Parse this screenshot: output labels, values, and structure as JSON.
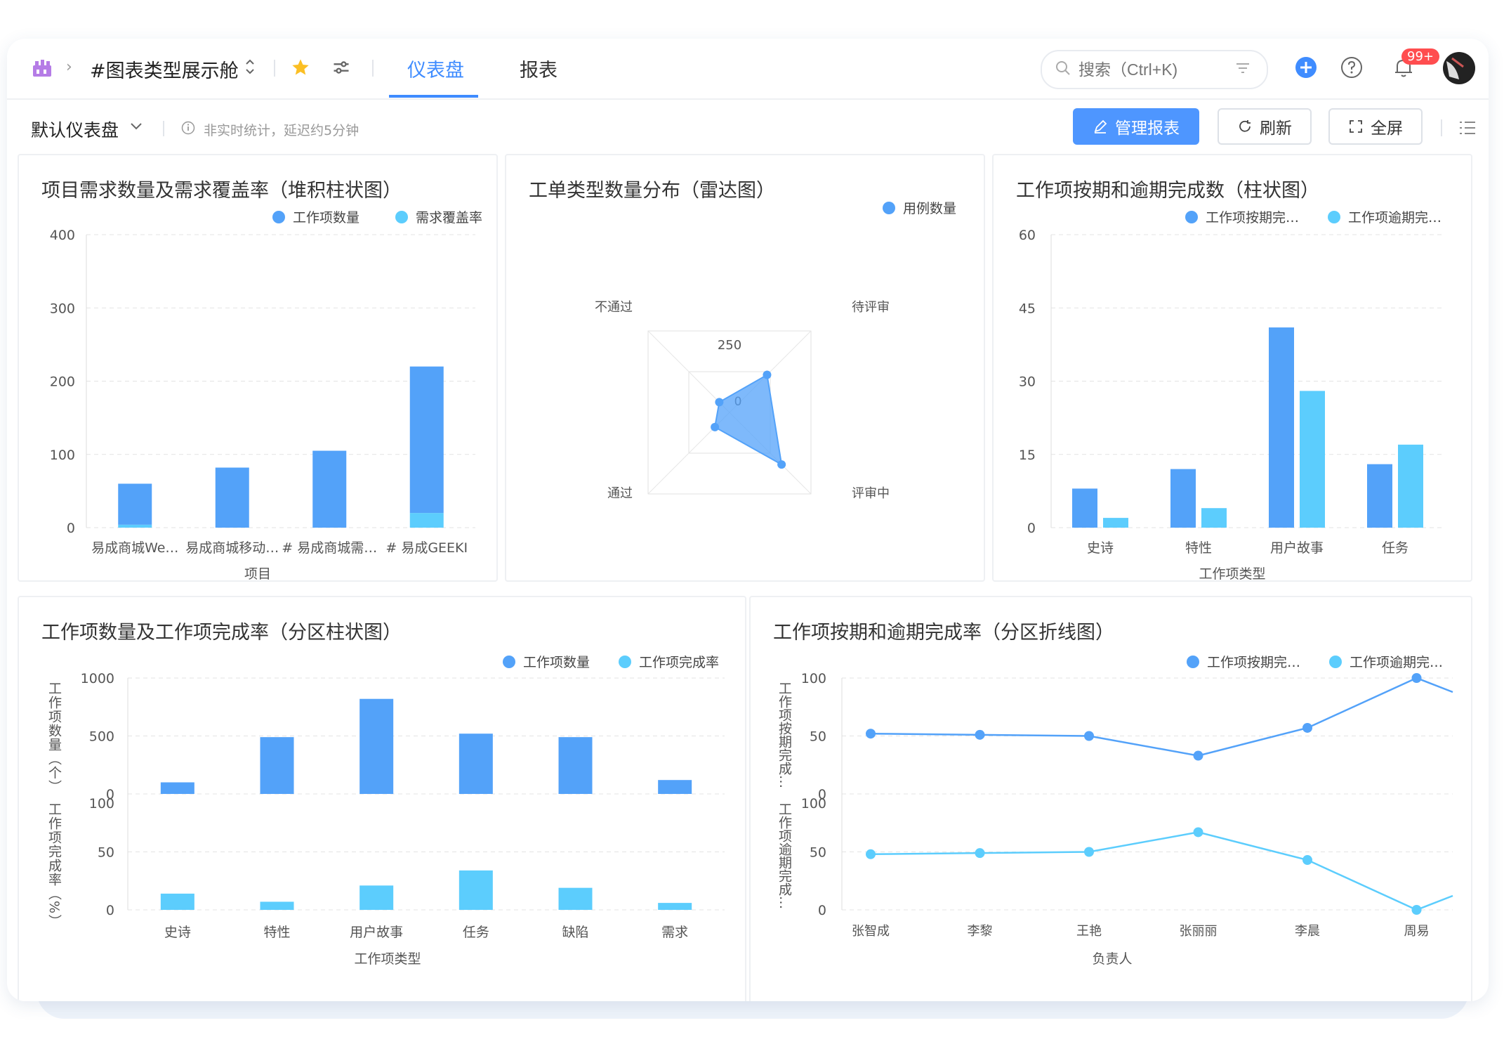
{
  "topbar": {
    "project_title": "#图表类型展示舱",
    "tabs": [
      {
        "label": "仪表盘",
        "active": true
      },
      {
        "label": "报表",
        "active": false
      }
    ],
    "search_placeholder": "搜索（Ctrl+K)",
    "notification_count": "99+"
  },
  "toolbar": {
    "dashboard_name": "默认仪表盘",
    "info_text": "非实时统计，延迟约5分钟",
    "manage_label": "管理报表",
    "refresh_label": "刷新",
    "fullscreen_label": "全屏"
  },
  "colors": {
    "primary": "#4e96ff",
    "dark_bar": "#53a2f9",
    "light_bar": "#5ccdfd",
    "accent": "#3f8cff"
  },
  "charts": {
    "stacked": {
      "title": "项目需求数量及需求覆盖率（堆积柱状图）",
      "legend": [
        "工作项数量",
        "需求覆盖率"
      ],
      "xlabel": "项目",
      "y_ticks": [
        "400",
        "300",
        "200",
        "100",
        "0"
      ],
      "x_labels": [
        "易成商城We…",
        "易成商城移动…",
        "# 易成商城需…",
        "# 易成GEEKI"
      ]
    },
    "radar": {
      "title": "工单类型数量分布（雷达图）",
      "legend": [
        "用例数量"
      ],
      "axes": [
        "待评审",
        "评审中",
        "通过",
        "不通过"
      ],
      "ring_labels": [
        "250",
        "0"
      ]
    },
    "bar": {
      "title": "工作项按期和逾期完成数（柱状图）",
      "legend": [
        "工作项按期完…",
        "工作项逾期完…"
      ],
      "xlabel": "工作项类型",
      "y_ticks": [
        "60",
        "45",
        "30",
        "15",
        "0"
      ],
      "x_labels": [
        "史诗",
        "特性",
        "用户故事",
        "任务"
      ]
    },
    "split_bar": {
      "title": "工作项数量及工作项完成率（分区柱状图）",
      "legend": [
        "工作项数量",
        "工作项完成率"
      ],
      "xlabel": "工作项类型",
      "ylabel_top": "工作项数量（个）",
      "ylabel_bottom": "工作项完成率（%）",
      "top_ticks": [
        "1000",
        "500",
        "0"
      ],
      "bottom_ticks": [
        "100",
        "50",
        "0"
      ],
      "x_labels": [
        "史诗",
        "特性",
        "用户故事",
        "任务",
        "缺陷",
        "需求"
      ]
    },
    "split_line": {
      "title": "工作项按期和逾期完成率（分区折线图）",
      "legend": [
        "工作项按期完…",
        "工作项逾期完…"
      ],
      "xlabel": "负责人",
      "ylabel_top": "工作项按期完成…",
      "ylabel_bottom": "工作项逾期完成…",
      "top_ticks": [
        "100",
        "50",
        "0"
      ],
      "bottom_ticks": [
        "100",
        "50",
        "0"
      ],
      "x_labels": [
        "张智成",
        "李黎",
        "王艳",
        "张丽丽",
        "李晨",
        "周易"
      ]
    }
  },
  "chart_data": [
    {
      "type": "bar",
      "title": "项目需求数量及需求覆盖率（堆积柱状图）",
      "xlabel": "项目",
      "stacked": true,
      "ylim": [
        0,
        400
      ],
      "categories": [
        "易成商城We…",
        "易成商城移动…",
        "# 易成商城需…",
        "# 易成GEEKI"
      ],
      "series": [
        {
          "name": "工作项数量",
          "values": [
            56,
            82,
            105,
            200
          ]
        },
        {
          "name": "需求覆盖率",
          "values": [
            4,
            0,
            0,
            20
          ]
        }
      ]
    },
    {
      "type": "radar",
      "title": "工单类型数量分布（雷达图）",
      "axes": [
        "待评审",
        "评审中",
        "通过",
        "不通过"
      ],
      "series": [
        {
          "name": "用例数量",
          "values": [
            180,
            300,
            50,
            25
          ]
        }
      ]
    },
    {
      "type": "bar",
      "title": "工作项按期和逾期完成数（柱状图）",
      "xlabel": "工作项类型",
      "ylim": [
        0,
        60
      ],
      "categories": [
        "史诗",
        "特性",
        "用户故事",
        "任务"
      ],
      "series": [
        {
          "name": "工作项按期完…",
          "values": [
            8,
            12,
            41,
            13
          ]
        },
        {
          "name": "工作项逾期完…",
          "values": [
            2,
            4,
            28,
            17
          ]
        }
      ]
    },
    {
      "type": "bar",
      "title": "工作项数量及工作项完成率（分区柱状图）",
      "xlabel": "工作项类型",
      "categories": [
        "史诗",
        "特性",
        "用户故事",
        "任务",
        "缺陷",
        "需求"
      ],
      "series": [
        {
          "name": "工作项数量",
          "values": [
            100,
            490,
            820,
            520,
            490,
            120
          ],
          "ylim": [
            0,
            1000
          ]
        },
        {
          "name": "工作项完成率",
          "values": [
            14,
            7,
            21,
            34,
            19,
            6
          ],
          "ylim": [
            0,
            100
          ]
        }
      ]
    },
    {
      "type": "line",
      "title": "工作项按期和逾期完成率（分区折线图）",
      "xlabel": "负责人",
      "categories": [
        "张智成",
        "李黎",
        "王艳",
        "张丽丽",
        "李晨",
        "周易"
      ],
      "series": [
        {
          "name": "工作项按期完…",
          "values": [
            52,
            51,
            50,
            33,
            57,
            100
          ],
          "ylim": [
            0,
            100
          ]
        },
        {
          "name": "工作项逾期完…",
          "values": [
            48,
            49,
            50,
            67,
            43,
            0
          ],
          "ylim": [
            0,
            100
          ]
        }
      ]
    }
  ]
}
